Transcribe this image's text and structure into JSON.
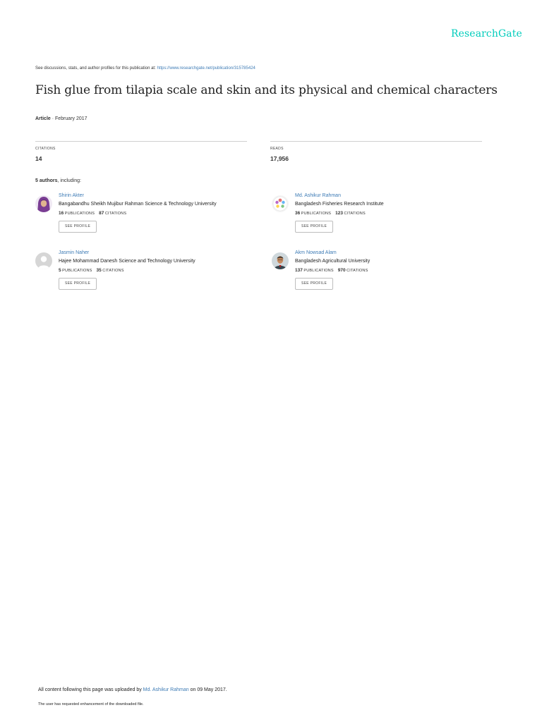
{
  "brand": {
    "logo": "ResearchGate"
  },
  "discussion": {
    "prefix": "See discussions, stats, and author profiles for this publication at: ",
    "link": "https://www.researchgate.net/publication/315785424"
  },
  "publication": {
    "title": "Fish glue from tilapia scale and skin and its physical and chemical characters",
    "type": "Article",
    "date": "· February 2017"
  },
  "stats": {
    "citations": {
      "label": "CITATIONS",
      "value": "14"
    },
    "reads": {
      "label": "READS",
      "value": "17,956"
    }
  },
  "authors_heading": {
    "count": "5 authors",
    "suffix": ", including:"
  },
  "authors": [
    {
      "name": "Shirin Akter",
      "institution": "Bangabandhu Sheikh Mujibur Rahman Science & Technology University",
      "publications": "16",
      "publications_label": "PUBLICATIONS",
      "citations": "87",
      "citations_label": "CITATIONS",
      "button": "SEE PROFILE"
    },
    {
      "name": "Md. Ashikur Rahman",
      "institution": "Bangladesh Fisheries Research Institute",
      "publications": "36",
      "publications_label": "PUBLICATIONS",
      "citations": "123",
      "citations_label": "CITATIONS",
      "button": "SEE PROFILE"
    },
    {
      "name": "Jasmin Naher",
      "institution": "Hajee Mohammad Danesh Science and Technology University",
      "publications": "5",
      "publications_label": "PUBLICATIONS",
      "citations": "35",
      "citations_label": "CITATIONS",
      "button": "SEE PROFILE"
    },
    {
      "name": "Akm Nowsad Alam",
      "institution": "Bangladesh Agricultural University",
      "publications": "137",
      "publications_label": "PUBLICATIONS",
      "citations": "970",
      "citations_label": "CITATIONS",
      "button": "SEE PROFILE"
    }
  ],
  "footer": {
    "uploaded_prefix": "All content following this page was uploaded by ",
    "uploader": "Md. Ashikur Rahman",
    "uploaded_suffix": " on 09 May 2017.",
    "note": "The user has requested enhancement of the downloaded file."
  },
  "colors": {
    "brand": "#00ccbb",
    "link": "#3d7bb5"
  },
  "icons": {
    "avatar_1": "woman-hijab-avatar",
    "avatar_2": "logo-avatar",
    "avatar_3": "default-avatar",
    "avatar_4": "man-photo-avatar"
  }
}
